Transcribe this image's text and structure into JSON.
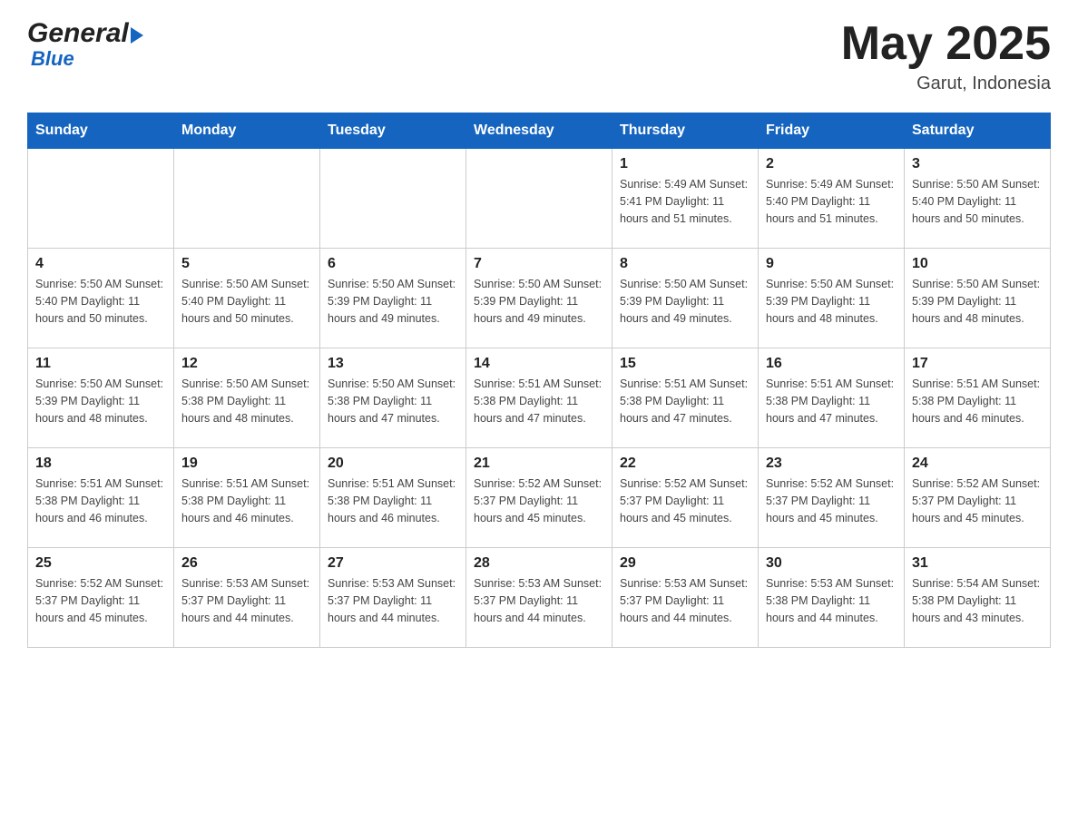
{
  "header": {
    "logo_text_general": "General",
    "logo_text_blue": "Blue",
    "month_year": "May 2025",
    "location": "Garut, Indonesia"
  },
  "weekdays": [
    "Sunday",
    "Monday",
    "Tuesday",
    "Wednesday",
    "Thursday",
    "Friday",
    "Saturday"
  ],
  "weeks": [
    [
      {
        "day": "",
        "info": ""
      },
      {
        "day": "",
        "info": ""
      },
      {
        "day": "",
        "info": ""
      },
      {
        "day": "",
        "info": ""
      },
      {
        "day": "1",
        "info": "Sunrise: 5:49 AM\nSunset: 5:41 PM\nDaylight: 11 hours\nand 51 minutes."
      },
      {
        "day": "2",
        "info": "Sunrise: 5:49 AM\nSunset: 5:40 PM\nDaylight: 11 hours\nand 51 minutes."
      },
      {
        "day": "3",
        "info": "Sunrise: 5:50 AM\nSunset: 5:40 PM\nDaylight: 11 hours\nand 50 minutes."
      }
    ],
    [
      {
        "day": "4",
        "info": "Sunrise: 5:50 AM\nSunset: 5:40 PM\nDaylight: 11 hours\nand 50 minutes."
      },
      {
        "day": "5",
        "info": "Sunrise: 5:50 AM\nSunset: 5:40 PM\nDaylight: 11 hours\nand 50 minutes."
      },
      {
        "day": "6",
        "info": "Sunrise: 5:50 AM\nSunset: 5:39 PM\nDaylight: 11 hours\nand 49 minutes."
      },
      {
        "day": "7",
        "info": "Sunrise: 5:50 AM\nSunset: 5:39 PM\nDaylight: 11 hours\nand 49 minutes."
      },
      {
        "day": "8",
        "info": "Sunrise: 5:50 AM\nSunset: 5:39 PM\nDaylight: 11 hours\nand 49 minutes."
      },
      {
        "day": "9",
        "info": "Sunrise: 5:50 AM\nSunset: 5:39 PM\nDaylight: 11 hours\nand 48 minutes."
      },
      {
        "day": "10",
        "info": "Sunrise: 5:50 AM\nSunset: 5:39 PM\nDaylight: 11 hours\nand 48 minutes."
      }
    ],
    [
      {
        "day": "11",
        "info": "Sunrise: 5:50 AM\nSunset: 5:39 PM\nDaylight: 11 hours\nand 48 minutes."
      },
      {
        "day": "12",
        "info": "Sunrise: 5:50 AM\nSunset: 5:38 PM\nDaylight: 11 hours\nand 48 minutes."
      },
      {
        "day": "13",
        "info": "Sunrise: 5:50 AM\nSunset: 5:38 PM\nDaylight: 11 hours\nand 47 minutes."
      },
      {
        "day": "14",
        "info": "Sunrise: 5:51 AM\nSunset: 5:38 PM\nDaylight: 11 hours\nand 47 minutes."
      },
      {
        "day": "15",
        "info": "Sunrise: 5:51 AM\nSunset: 5:38 PM\nDaylight: 11 hours\nand 47 minutes."
      },
      {
        "day": "16",
        "info": "Sunrise: 5:51 AM\nSunset: 5:38 PM\nDaylight: 11 hours\nand 47 minutes."
      },
      {
        "day": "17",
        "info": "Sunrise: 5:51 AM\nSunset: 5:38 PM\nDaylight: 11 hours\nand 46 minutes."
      }
    ],
    [
      {
        "day": "18",
        "info": "Sunrise: 5:51 AM\nSunset: 5:38 PM\nDaylight: 11 hours\nand 46 minutes."
      },
      {
        "day": "19",
        "info": "Sunrise: 5:51 AM\nSunset: 5:38 PM\nDaylight: 11 hours\nand 46 minutes."
      },
      {
        "day": "20",
        "info": "Sunrise: 5:51 AM\nSunset: 5:38 PM\nDaylight: 11 hours\nand 46 minutes."
      },
      {
        "day": "21",
        "info": "Sunrise: 5:52 AM\nSunset: 5:37 PM\nDaylight: 11 hours\nand 45 minutes."
      },
      {
        "day": "22",
        "info": "Sunrise: 5:52 AM\nSunset: 5:37 PM\nDaylight: 11 hours\nand 45 minutes."
      },
      {
        "day": "23",
        "info": "Sunrise: 5:52 AM\nSunset: 5:37 PM\nDaylight: 11 hours\nand 45 minutes."
      },
      {
        "day": "24",
        "info": "Sunrise: 5:52 AM\nSunset: 5:37 PM\nDaylight: 11 hours\nand 45 minutes."
      }
    ],
    [
      {
        "day": "25",
        "info": "Sunrise: 5:52 AM\nSunset: 5:37 PM\nDaylight: 11 hours\nand 45 minutes."
      },
      {
        "day": "26",
        "info": "Sunrise: 5:53 AM\nSunset: 5:37 PM\nDaylight: 11 hours\nand 44 minutes."
      },
      {
        "day": "27",
        "info": "Sunrise: 5:53 AM\nSunset: 5:37 PM\nDaylight: 11 hours\nand 44 minutes."
      },
      {
        "day": "28",
        "info": "Sunrise: 5:53 AM\nSunset: 5:37 PM\nDaylight: 11 hours\nand 44 minutes."
      },
      {
        "day": "29",
        "info": "Sunrise: 5:53 AM\nSunset: 5:37 PM\nDaylight: 11 hours\nand 44 minutes."
      },
      {
        "day": "30",
        "info": "Sunrise: 5:53 AM\nSunset: 5:38 PM\nDaylight: 11 hours\nand 44 minutes."
      },
      {
        "day": "31",
        "info": "Sunrise: 5:54 AM\nSunset: 5:38 PM\nDaylight: 11 hours\nand 43 minutes."
      }
    ]
  ]
}
